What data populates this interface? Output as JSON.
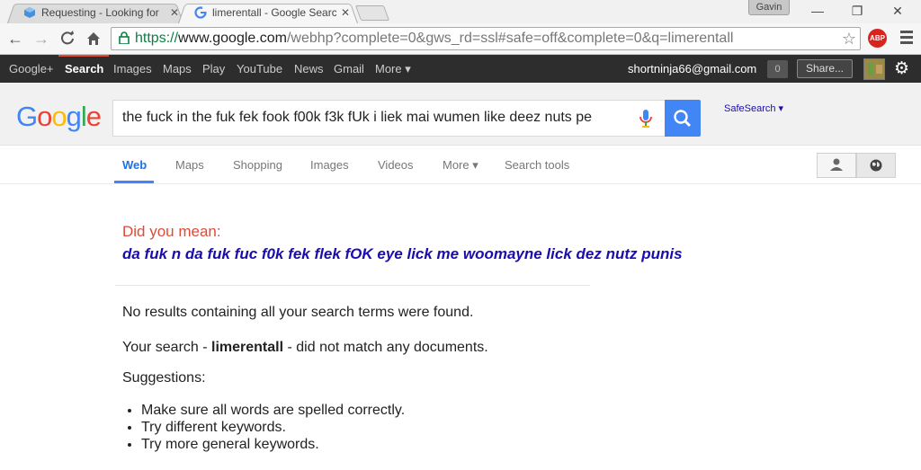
{
  "browser": {
    "tabs": [
      {
        "title": "Requesting - Looking for",
        "close": "✕"
      },
      {
        "title": "limerentall - Google Search",
        "close": "✕"
      }
    ],
    "profile_name": "Gavin",
    "window_controls": {
      "minimize": "—",
      "restore": "❐",
      "close": "✕"
    },
    "url": {
      "scheme": "https://",
      "host": "www.google.com",
      "rest": "/webhp?complete=0&gws_rd=ssl#safe=off&complete=0&q=limerentall"
    },
    "abp_label": "ABP"
  },
  "gbar": {
    "links": [
      "Google+",
      "Search",
      "Images",
      "Maps",
      "Play",
      "YouTube",
      "News",
      "Gmail",
      "More ▾"
    ],
    "active": "Search",
    "email": "shortninja66@gmail.com",
    "notification_count": "0",
    "share_label": "Share..."
  },
  "search": {
    "query": "the fuck in the fuk fek fook f00k f3k fUk i liek mai wumen like deez nuts pe",
    "safesearch_label": "SafeSearch ▾"
  },
  "search_tabs": [
    "Web",
    "Maps",
    "Shopping",
    "Images",
    "Videos",
    "More ▾",
    "Search tools"
  ],
  "active_search_tab": "Web",
  "results": {
    "did_you_mean_label": "Did you mean:",
    "did_you_mean_suggestion": "da fuk n da fuk fuc f0k fek flek fOK eye lick me woomayne lick dez nutz punis",
    "no_results": "No results containing all your search terms were found.",
    "your_search_prefix": "Your search - ",
    "your_search_term": "limerentall",
    "your_search_suffix": " - did not match any documents.",
    "suggestions_label": "Suggestions:",
    "suggestions": [
      "Make sure all words are spelled correctly.",
      "Try different keywords.",
      "Try more general keywords."
    ]
  },
  "colors": {
    "did_you_mean": "#dd4b39",
    "link": "#1a0dab",
    "search_button": "#4285f4",
    "gbar_background": "#2d2d2d",
    "url_green": "#0b8043"
  }
}
